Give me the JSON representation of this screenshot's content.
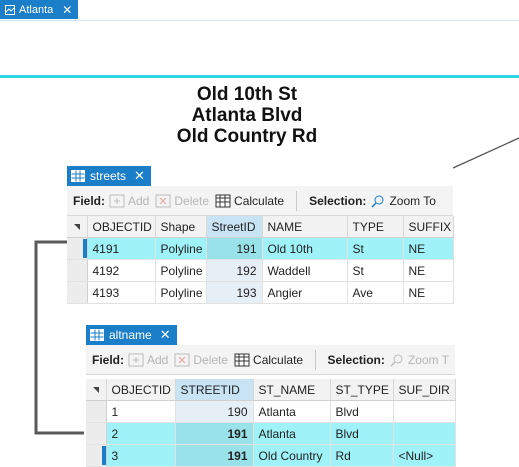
{
  "map": {
    "tab_label": "Atlanta",
    "close_glyph": "✕",
    "street_labels": [
      "Old 10th St",
      "Atlanta Blvd",
      "Old Country Rd"
    ],
    "colors": {
      "accent": "#1b7ec8",
      "street": "#2fd3e3",
      "highlight": "#9ef2f8"
    }
  },
  "streets_table": {
    "tab_label": "streets",
    "close_glyph": "✕",
    "toolbar": {
      "field_label": "Field:",
      "add_label": "Add",
      "delete_label": "Delete",
      "calculate_label": "Calculate",
      "selection_label": "Selection:",
      "zoom_label": "Zoom To"
    },
    "columns": [
      "OBJECTID",
      "Shape",
      "StreetID",
      "NAME",
      "TYPE",
      "SUFFIX"
    ],
    "rows": [
      [
        "4191",
        "Polyline",
        "191",
        "Old 10th",
        "St",
        "NE"
      ],
      [
        "4192",
        "Polyline",
        "192",
        "Waddell",
        "St",
        "NE"
      ],
      [
        "4193",
        "Polyline",
        "193",
        "Angier",
        "Ave",
        "NE"
      ]
    ]
  },
  "altname_table": {
    "tab_label": "altname",
    "close_glyph": "✕",
    "toolbar": {
      "field_label": "Field:",
      "add_label": "Add",
      "delete_label": "Delete",
      "calculate_label": "Calculate",
      "selection_label": "Selection:",
      "zoom_label": "Zoom T"
    },
    "columns": [
      "OBJECTID",
      "STREETID",
      "ST_NAME",
      "ST_TYPE",
      "SUF_DIR"
    ],
    "rows": [
      [
        "1",
        "190",
        "Atlanta",
        "Blvd",
        ""
      ],
      [
        "2",
        "191",
        "Atlanta",
        "Blvd",
        ""
      ],
      [
        "3",
        "191",
        "Old Country",
        "Rd",
        "<Null>"
      ]
    ]
  }
}
